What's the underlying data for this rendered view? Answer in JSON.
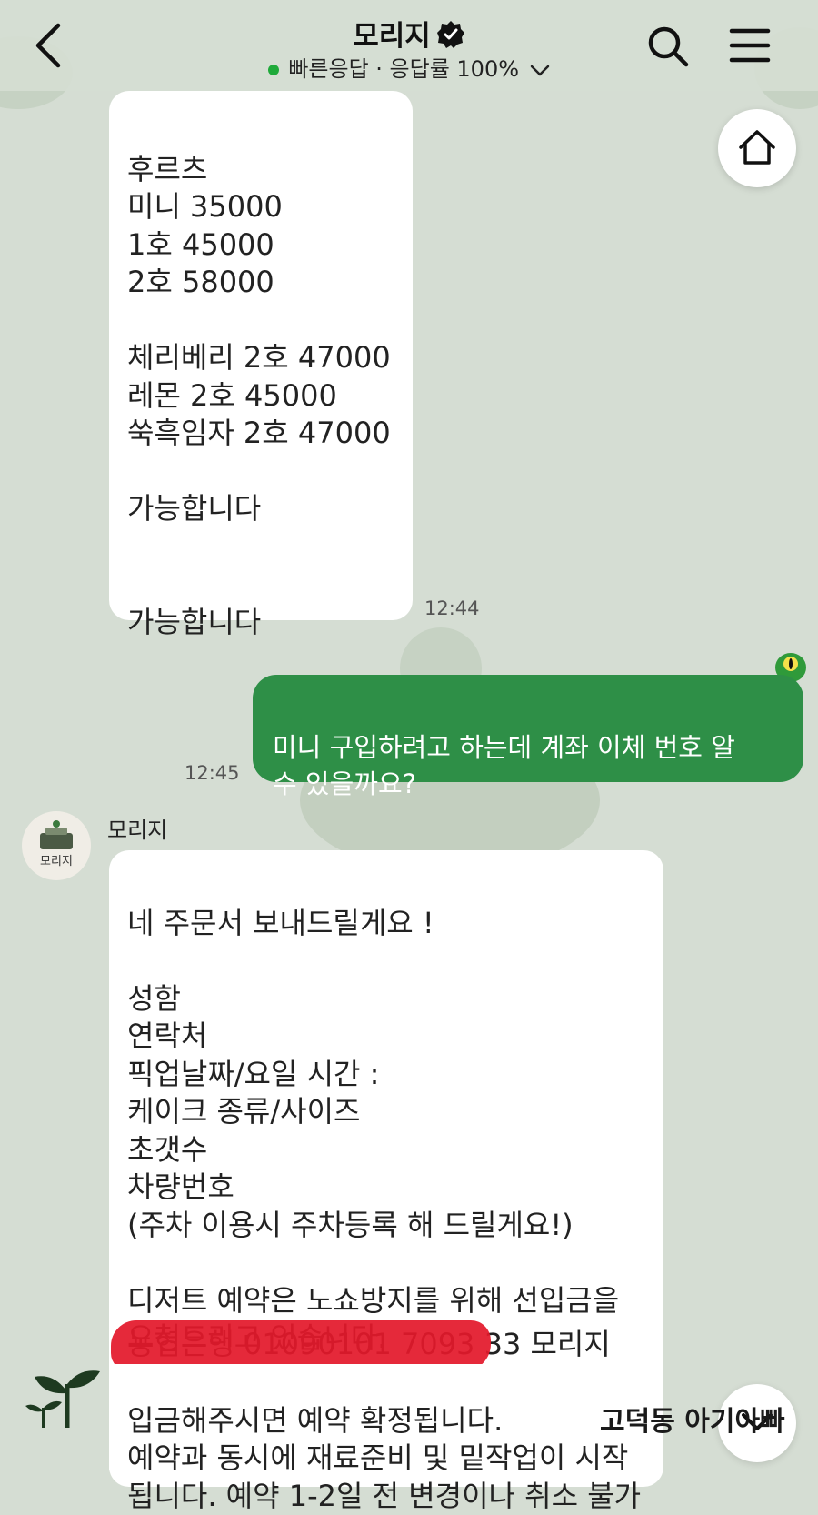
{
  "header": {
    "title": "모리지",
    "status": "빠른응답 · 응답률 100%"
  },
  "messages": [
    {
      "type": "incoming",
      "text": "후르츠\n미니 35000\n1호 45000\n2호 58000\n\n체리베리 2호 47000\n레몬 2호 45000\n쑥흑임자 2호 47000\n\n가능합니다\n\n\n가능합니다",
      "time": "12:44"
    },
    {
      "type": "outgoing",
      "text": "미니 구입하려고 하는데 계좌 이체 번호 알\n수 있을까요?",
      "time": "12:45"
    },
    {
      "type": "incoming",
      "sender": "모리지",
      "avatar_text": "모리지",
      "text": "네 주문서 보내드릴게요 !\n\n성함\n연락처\n픽업날짜/요일 시간 :\n케이크 종류/사이즈\n초갯수\n차량번호\n(주차 이용시 주차등록 해 드릴게요!)\n\n디저트 예약은 노쇼방지를 위해 선입금을\n요청드리고 있습니다.",
      "account_line": "농협은행 01090101 7093 33 모리지",
      "text_after": "입금해주시면 예약 확정됩니다.\n예약과 동시에 재료준비 및 밑작업이 시작\n됩니다. 예약 1-2일 전 변경이나 취소 불가"
    }
  ],
  "watermark": "고덕동 아기아빠",
  "icons": {
    "back": "back-arrow-icon",
    "verified": "verified-badge-icon",
    "chevron": "chevron-down-icon",
    "search": "search-icon",
    "menu": "hamburger-menu-icon",
    "home": "home-icon",
    "scroll_down": "chevron-down-icon",
    "sprout": "sprout-icon",
    "frog": "frog-emoticon-icon"
  },
  "colors": {
    "background": "#d5ddd3",
    "outgoing_bubble": "#2e8f47",
    "incoming_bubble": "#ffffff",
    "online_dot": "#1faa3a",
    "redaction": "#e3192b"
  }
}
